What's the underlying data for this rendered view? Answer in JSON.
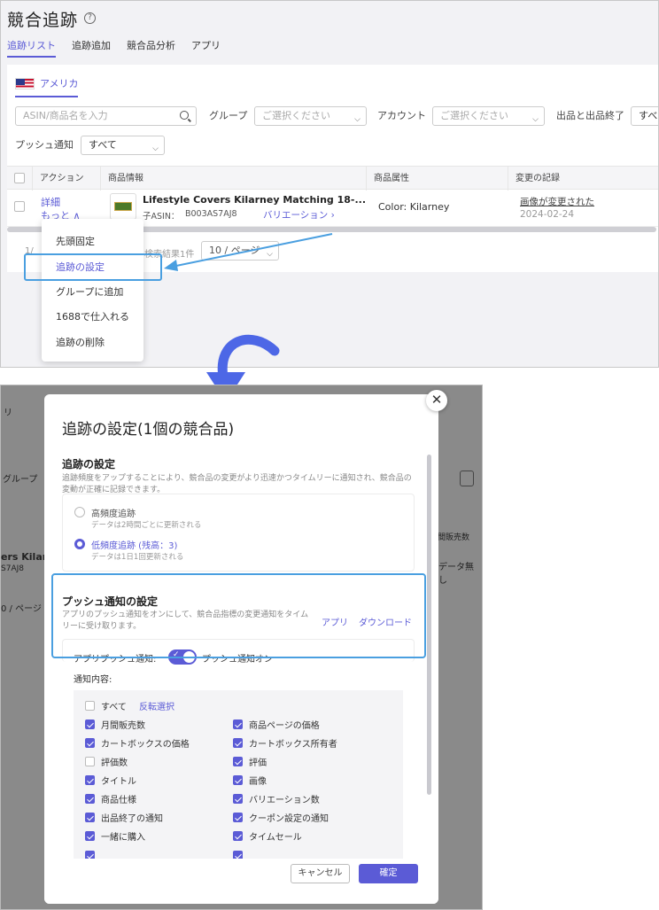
{
  "top": {
    "title": "競合追跡",
    "help_glyph": "?",
    "tabs": [
      "追跡リスト",
      "追跡追加",
      "競合品分析",
      "アプリ"
    ],
    "country": "アメリカ",
    "search_placeholder": "ASIN/商品名を入力",
    "group_label": "グループ",
    "group_placeholder": "ご選択ください",
    "account_label": "アカウント",
    "account_placeholder": "ご選択ください",
    "listing_label": "出品と出品終了",
    "listing_value": "すべ",
    "push_label": "プッシュ通知",
    "push_value": "すべて",
    "columns": [
      "アクション",
      "商品情報",
      "商品属性",
      "変更の記録"
    ],
    "row": {
      "detail": "詳細",
      "more": "もっと ∧",
      "product_name": "Lifestyle Covers Kilarney Matching 18-...",
      "asin_label": "子ASIN：",
      "asin": "B003AS7AJ8",
      "variation": "バリエーション ›",
      "attribute": "Color: Kilarney",
      "change": "画像が変更された",
      "date": "2024-02-24"
    },
    "pager_partial": "1/",
    "results": "検索結果1件",
    "page_size": "10 / ページ",
    "menu": [
      "先頭固定",
      "追跡の設定",
      "グループに追加",
      "1688で仕入れる",
      "追跡の削除"
    ],
    "highlight_color": "#4a9fe0"
  },
  "bottom": {
    "bg": {
      "l1": "リ",
      "l2": "グループ",
      "l3": "ers Kilarne",
      "l4": "S7AJ8",
      "l5": "0 / ページ",
      "r1": "間販売数",
      "r2": "データ無し"
    },
    "modal_title": "追跡の設定(1個の競合品)",
    "track_title": "追跡の設定",
    "track_desc": "追跡頻度をアップすることにより、競合品の変更がより迅速かつタイムリーに通知され、競合品の変動が正確に記録できます。",
    "high_label": "高頻度追跡",
    "high_sub": "データは2時間ごとに更新される",
    "low_label": "低頻度追跡 (残高：3)",
    "low_sub": "データは1日1回更新される",
    "push_title": "プッシュ通知の設定",
    "push_desc": "アプリのプッシュ通知をオンにして、競合品指標の変更通知をタイムリーに受け取ります。",
    "app_link": "アプリ",
    "download_link": "ダウンロード",
    "app_push_label": "アプリプッシュ通知:",
    "push_on": "プッシュ通知オン",
    "notify_label": "通知内容:",
    "all_label": "すべて",
    "invert_label": "反転選択",
    "items": [
      {
        "label": "月間販売数",
        "checked": true
      },
      {
        "label": "商品ページの価格",
        "checked": true
      },
      {
        "label": "カートボックスの価格",
        "checked": true
      },
      {
        "label": "カートボックス所有者",
        "checked": true
      },
      {
        "label": "評価数",
        "checked": false
      },
      {
        "label": "評価",
        "checked": true
      },
      {
        "label": "タイトル",
        "checked": true
      },
      {
        "label": "画像",
        "checked": true
      },
      {
        "label": "商品仕様",
        "checked": true
      },
      {
        "label": "バリエーション数",
        "checked": true
      },
      {
        "label": "出品終了の通知",
        "checked": true
      },
      {
        "label": "クーポン設定の通知",
        "checked": true
      },
      {
        "label": "一緒に購入",
        "checked": true
      },
      {
        "label": "タイムセール",
        "checked": true
      }
    ],
    "cancel": "キャンセル",
    "confirm": "確定",
    "close_glyph": "✕"
  }
}
